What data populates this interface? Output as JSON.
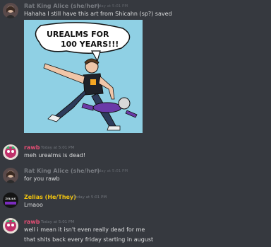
{
  "messages": [
    {
      "author": "Rat King Alice (she/her)",
      "timestamp": "Today at 5:01 PM",
      "lines": [
        "Hahaha I still have this art from Shicahn (sp?) saved"
      ],
      "author_color": "#8e9297",
      "avatar": "alice-avatar"
    },
    {
      "author": "rawb",
      "timestamp": "Today at 5:01 PM",
      "lines": [
        "meh urealms is dead!"
      ],
      "author_color": "#e84e75",
      "avatar": "rawb-avatar"
    },
    {
      "author": "Rat King Alice (she/her)",
      "timestamp": "Today at 5:01 PM",
      "lines": [
        "for you rawb"
      ],
      "author_color": "#8e9297",
      "avatar": "alice-avatar"
    },
    {
      "author": "Zelias (He/They)",
      "timestamp": "Today at 5:01 PM",
      "lines": [
        "Lmaoo"
      ],
      "author_color": "#f1c40f",
      "avatar": "zelias-avatar",
      "avatar_text": "ZELIAS"
    },
    {
      "author": "rawb",
      "timestamp": "Today at 5:01 PM",
      "lines": [
        "well i mean it isn't even really dead for me",
        "that shits back every friday starting in august"
      ],
      "author_color": "#e84e75",
      "avatar": "rawb-avatar"
    }
  ],
  "attachment": {
    "bubble_line1": "UREALMS FOR",
    "bubble_line2": "100 YEARS!!!"
  }
}
